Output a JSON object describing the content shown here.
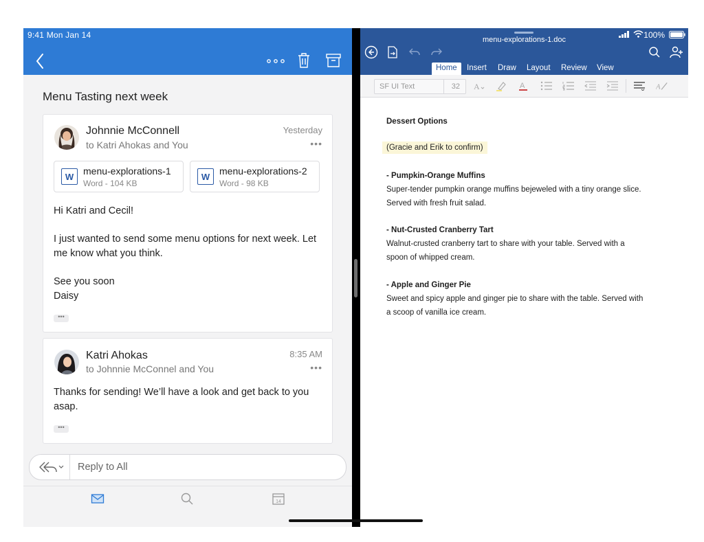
{
  "status_bar": {
    "time_date": "9:41  Mon Jan 14",
    "battery": "100%"
  },
  "mail": {
    "subject": "Menu Tasting next week",
    "messages": [
      {
        "sender": "Johnnie McConnell",
        "recipients": "to Katri Ahokas and You",
        "time": "Yesterday",
        "attachments": [
          {
            "name": "menu-explorations-1",
            "meta": "Word - 104 KB"
          },
          {
            "name": "menu-explorations-2",
            "meta": "Word - 98 KB"
          }
        ],
        "body": [
          "Hi Katri and Cecil!",
          "I just wanted to send some menu options for next week. Let me know what you think.",
          "See you soon",
          "Daisy"
        ]
      },
      {
        "sender": "Katri Ahokas",
        "recipients": "to Johnnie McConnel and You",
        "time": "8:35 AM",
        "body": [
          "Thanks for sending! We’ll have a look and get back to you asap."
        ]
      }
    ],
    "reply_placeholder": "Reply to All",
    "more_dots": "•••",
    "word_badge": "W"
  },
  "word": {
    "filename": "menu-explorations-1.doc",
    "ribbon_tabs": [
      "Home",
      "Insert",
      "Draw",
      "Layout",
      "Review",
      "View"
    ],
    "active_tab": "Home",
    "font_name": "SF UI Text",
    "font_size": "32",
    "document": {
      "heading": "Dessert Options",
      "note": "(Gracie and Erik to confirm)",
      "items": [
        {
          "title": "- Pumpkin-Orange Muffins",
          "lines": [
            "Super-tender pumpkin orange muffins bejeweled with a tiny orange slice.",
            "Served with fresh fruit salad."
          ]
        },
        {
          "title": "- Nut-Crusted Cranberry Tart",
          "lines": [
            "Walnut-crusted cranberry tart to share with your table. Served with a",
            "spoon of whipped cream."
          ]
        },
        {
          "title": "- Apple and Ginger Pie",
          "lines": [
            "Sweet and spicy apple and ginger pie to share with the table. Served with",
            "a scoop of vanilla ice cream."
          ]
        }
      ]
    }
  },
  "colors": {
    "outlook_blue": "#2e7bd5",
    "word_blue": "#2b579a"
  },
  "icons": [
    "back-chevron-icon",
    "more-icon",
    "trash-icon",
    "archive-icon",
    "reply-all-icon",
    "mail-icon",
    "search-icon",
    "calendar-icon",
    "word-back-icon",
    "file-icon",
    "undo-icon",
    "redo-icon",
    "share-person-icon"
  ]
}
